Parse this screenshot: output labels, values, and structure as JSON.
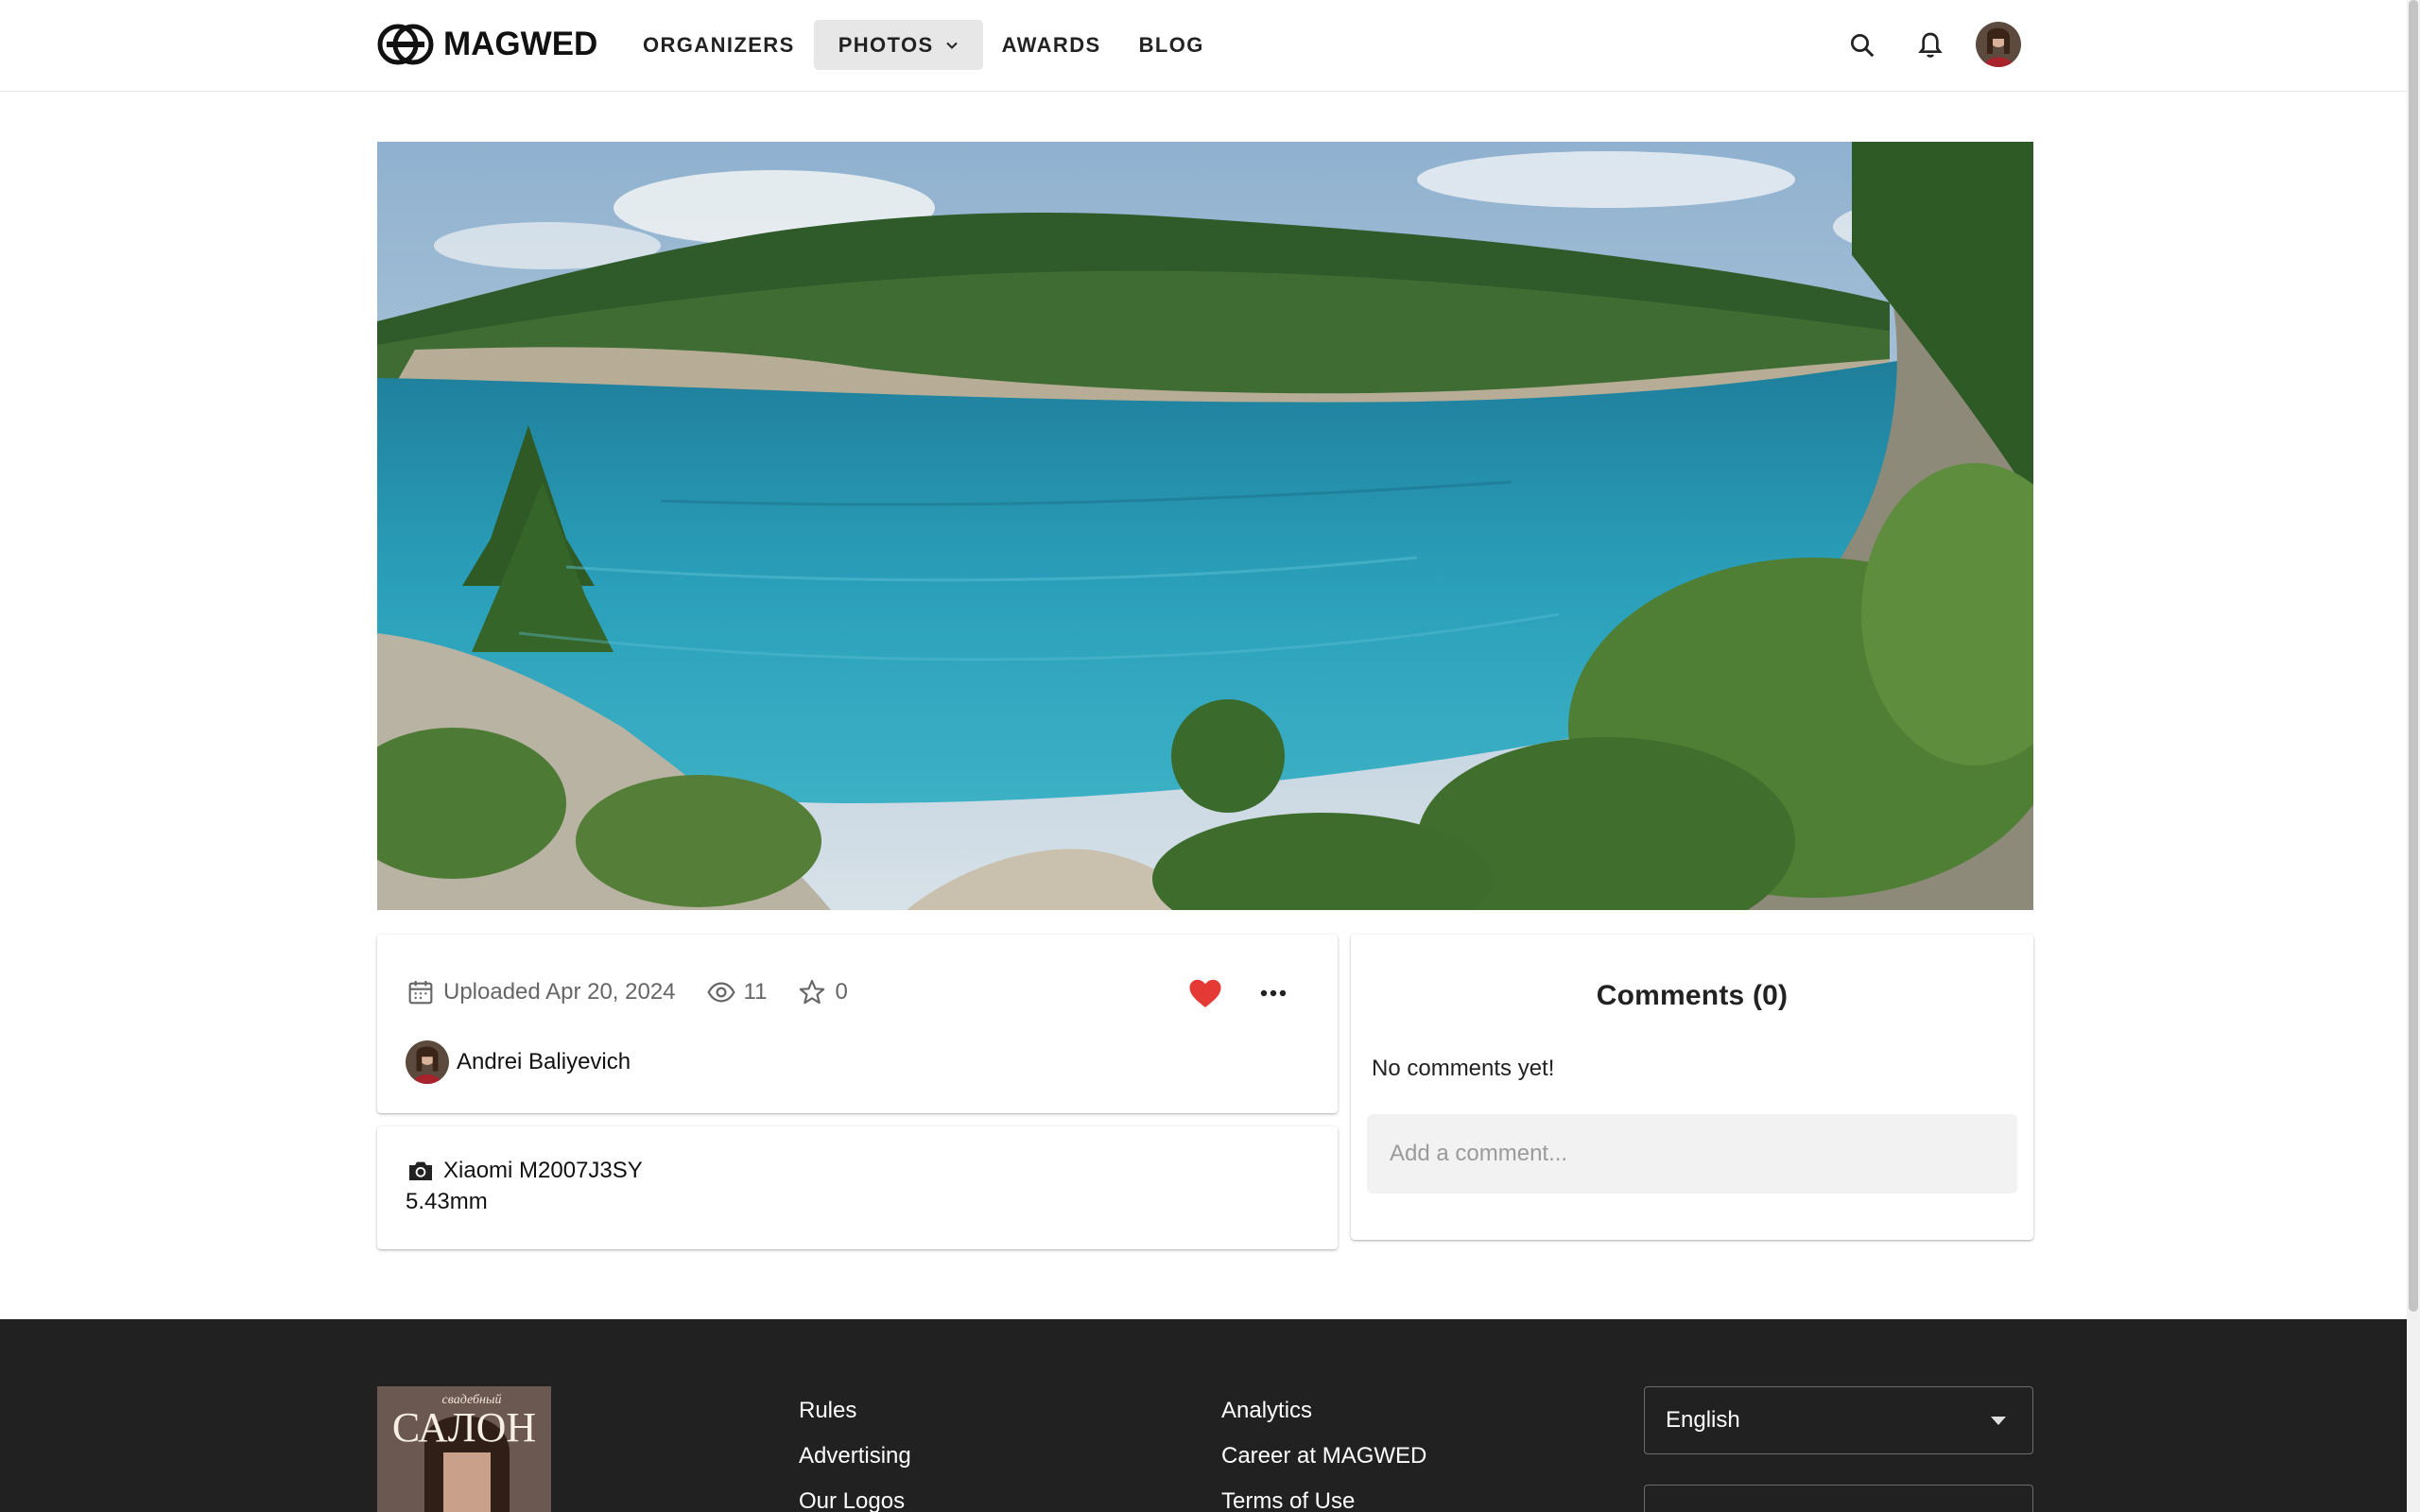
{
  "header": {
    "brand": "MAGWED",
    "nav": [
      {
        "label": "ORGANIZERS"
      },
      {
        "label": "PHOTOS"
      },
      {
        "label": "AWARDS"
      },
      {
        "label": "BLOG"
      }
    ],
    "icons": [
      "search-icon",
      "bell-icon",
      "avatar"
    ]
  },
  "photo": {
    "icon": "landscape-lake-photo"
  },
  "info": {
    "uploaded": "Uploaded Apr 20, 2024",
    "views": "11",
    "stars": "0",
    "author": "Andrei Baliyevich",
    "liked": true,
    "like_color": "#e53935"
  },
  "camera": {
    "model": "Xiaomi M2007J3SY",
    "focal": "5.43mm"
  },
  "comments": {
    "title": "Comments (0)",
    "empty": "No comments yet!",
    "placeholder": "Add a comment..."
  },
  "footer": {
    "col1": [
      "Rules",
      "Advertising",
      "Our Logos"
    ],
    "col2": [
      "Analytics",
      "Career at MAGWED",
      "Terms of Use"
    ],
    "language": "English",
    "magazine": "САЛОН",
    "magazine_small": "свадебный"
  }
}
